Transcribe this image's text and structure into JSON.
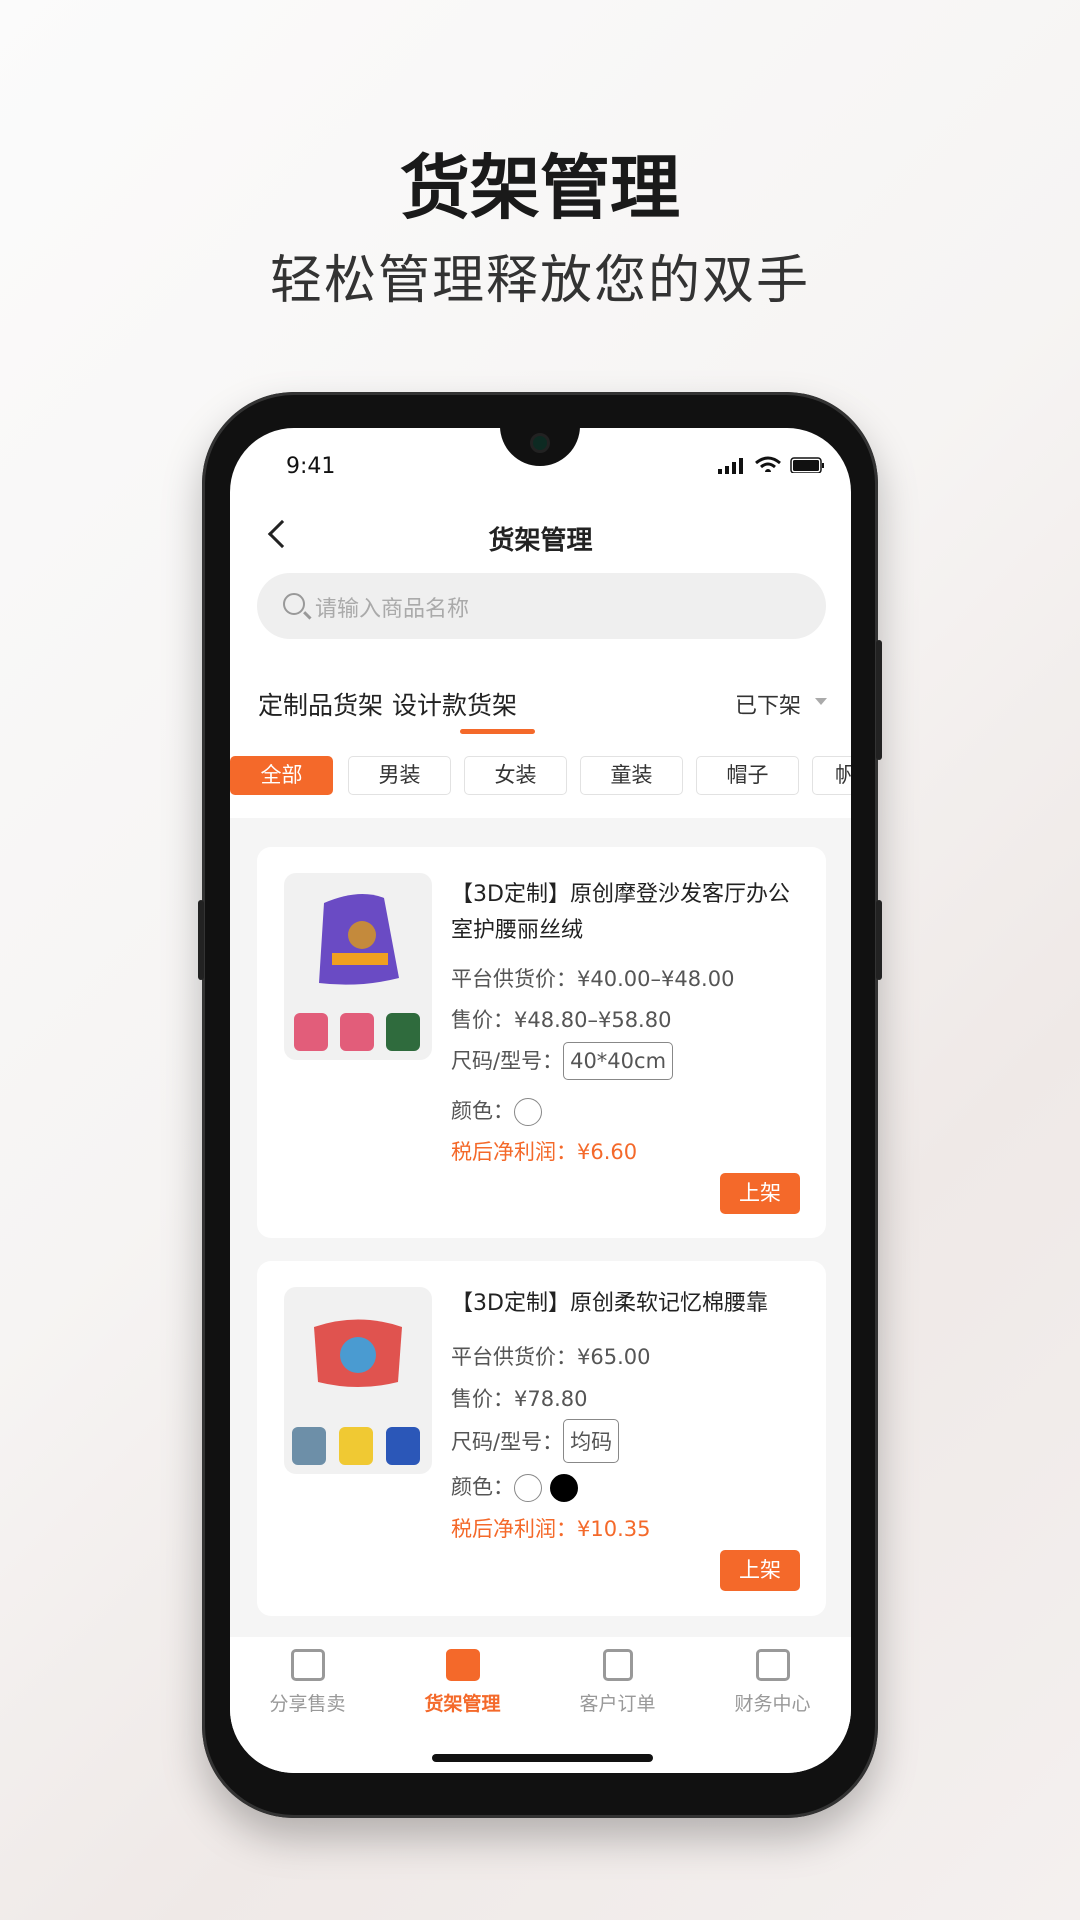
{
  "hero": {
    "title": "货架管理",
    "subtitle": "轻松管理释放您的双手"
  },
  "status_bar": {
    "time": "9:41"
  },
  "header": {
    "title": "货架管理"
  },
  "search": {
    "placeholder": "请输入商品名称"
  },
  "tabs": [
    {
      "label": "定制品货架",
      "active": false
    },
    {
      "label": "设计款货架",
      "active": true
    }
  ],
  "filter": {
    "label": "已下架"
  },
  "categories": [
    {
      "label": "全部",
      "active": true
    },
    {
      "label": "男装"
    },
    {
      "label": "女装"
    },
    {
      "label": "童装"
    },
    {
      "label": "帽子"
    },
    {
      "label": "帆"
    }
  ],
  "products": [
    {
      "title": "【3D定制】原创摩登沙发客厅办公室护腰丽丝绒",
      "supply_label": "平台供货价：",
      "supply": "¥40.00–¥48.00",
      "price_label": "售价：",
      "price": "¥48.80–¥58.80",
      "size_label": "尺码/型号：",
      "size": "40*40cm",
      "color_label": "颜色：",
      "colors": [
        "#ffffff"
      ],
      "profit_label": "税后净利润：",
      "profit": "¥6.60",
      "button": "上架"
    },
    {
      "title": "【3D定制】原创柔软记忆棉腰靠",
      "supply_label": "平台供货价：",
      "supply": "¥65.00",
      "price_label": "售价：",
      "price": "¥78.80",
      "size_label": "尺码/型号：",
      "size": "均码",
      "color_label": "颜色：",
      "colors": [
        "#ffffff",
        "#000000"
      ],
      "profit_label": "税后净利润：",
      "profit": "¥10.35",
      "button": "上架"
    }
  ],
  "tabbar": [
    {
      "label": "分享售卖",
      "icon": "store-icon"
    },
    {
      "label": "货架管理",
      "icon": "shopping-bag-icon",
      "active": true
    },
    {
      "label": "客户订单",
      "icon": "order-icon"
    },
    {
      "label": "财务中心",
      "icon": "wallet-icon"
    }
  ],
  "colors": {
    "accent": "#f4692a"
  }
}
